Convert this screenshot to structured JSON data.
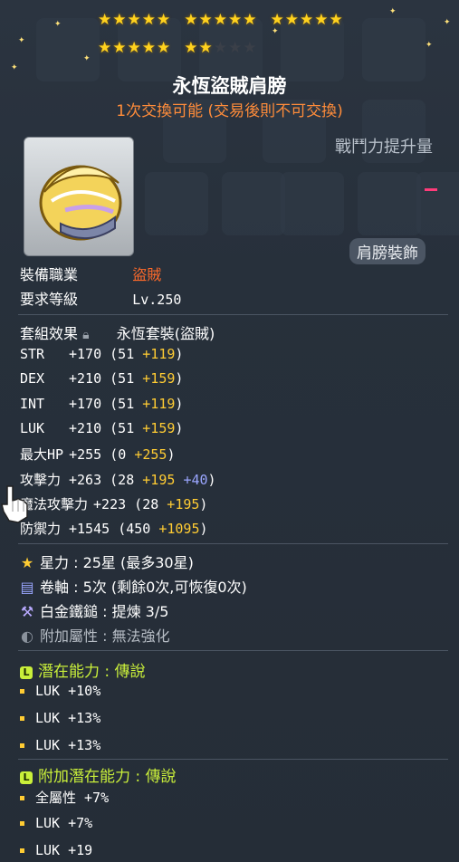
{
  "stars": {
    "filled": 22,
    "total": 25,
    "group_size": 5
  },
  "item": {
    "name": "永恆盜賊肩膀",
    "trade_note": "1次交換可能 (交易後則不可交換)",
    "combat_power_label": "戰鬥力提升量",
    "category": "肩膀裝飾"
  },
  "requirements": {
    "job_label": "裝備職業",
    "job_value": "盜賊",
    "level_label": "要求等級",
    "level_value": "Lv.250"
  },
  "set": {
    "label": "套組效果",
    "value": "永恆套裝(盜賊)"
  },
  "stats": [
    {
      "name": "STR",
      "total": "+170",
      "base": "(51",
      "bonus": "+119",
      "close": ")"
    },
    {
      "name": "DEX",
      "total": "+210",
      "base": "(51",
      "bonus": "+159",
      "close": ")"
    },
    {
      "name": "INT",
      "total": "+170",
      "base": "(51",
      "bonus": "+119",
      "close": ")"
    },
    {
      "name": "LUK",
      "total": "+210",
      "base": "(51",
      "bonus": "+159",
      "close": ")"
    },
    {
      "name": "最大HP",
      "total": "+255",
      "base": "(0",
      "bonus": "+255",
      "close": ")"
    },
    {
      "name": "攻擊力",
      "total": "+263",
      "base": "(28",
      "bonus": "+195",
      "extra": "+40",
      "close": ")"
    },
    {
      "name": "魔法攻擊力",
      "total": "+223",
      "base": "(28",
      "bonus": "+195",
      "close": ")"
    },
    {
      "name": "防禦力",
      "total": "+1545",
      "base": "(450",
      "bonus": "+1095",
      "close": ")"
    }
  ],
  "upgrades": {
    "starforce": "星力 : 25星 (最多30星)",
    "scroll": "卷軸 : 5次 (剩餘0次,可恢復0次)",
    "hammer": "白金鐵鎚 : 提煉 3/5",
    "soul": "附加屬性 : 無法強化"
  },
  "potential": {
    "header": "潛在能力 : 傳說",
    "lines": [
      "LUK +10%",
      "LUK +13%",
      "LUK +13%"
    ]
  },
  "additional_potential": {
    "header": "附加潛在能力 : 傳說",
    "lines": [
      "全屬性 +7%",
      "LUK +7%",
      "LUK +19"
    ]
  },
  "grade_icon": "L",
  "colors": {
    "job": "#ff6a2a",
    "trade_note": "#ff8c3a",
    "bonus": "#ffcc33",
    "extra": "#9aa6ff",
    "potential": "#c9ef3a"
  },
  "icons": [
    "star-icon",
    "scroll-icon",
    "hammer-icon",
    "soul-icon",
    "lock-icon",
    "shoulder-item-icon",
    "hand-cursor-icon"
  ]
}
